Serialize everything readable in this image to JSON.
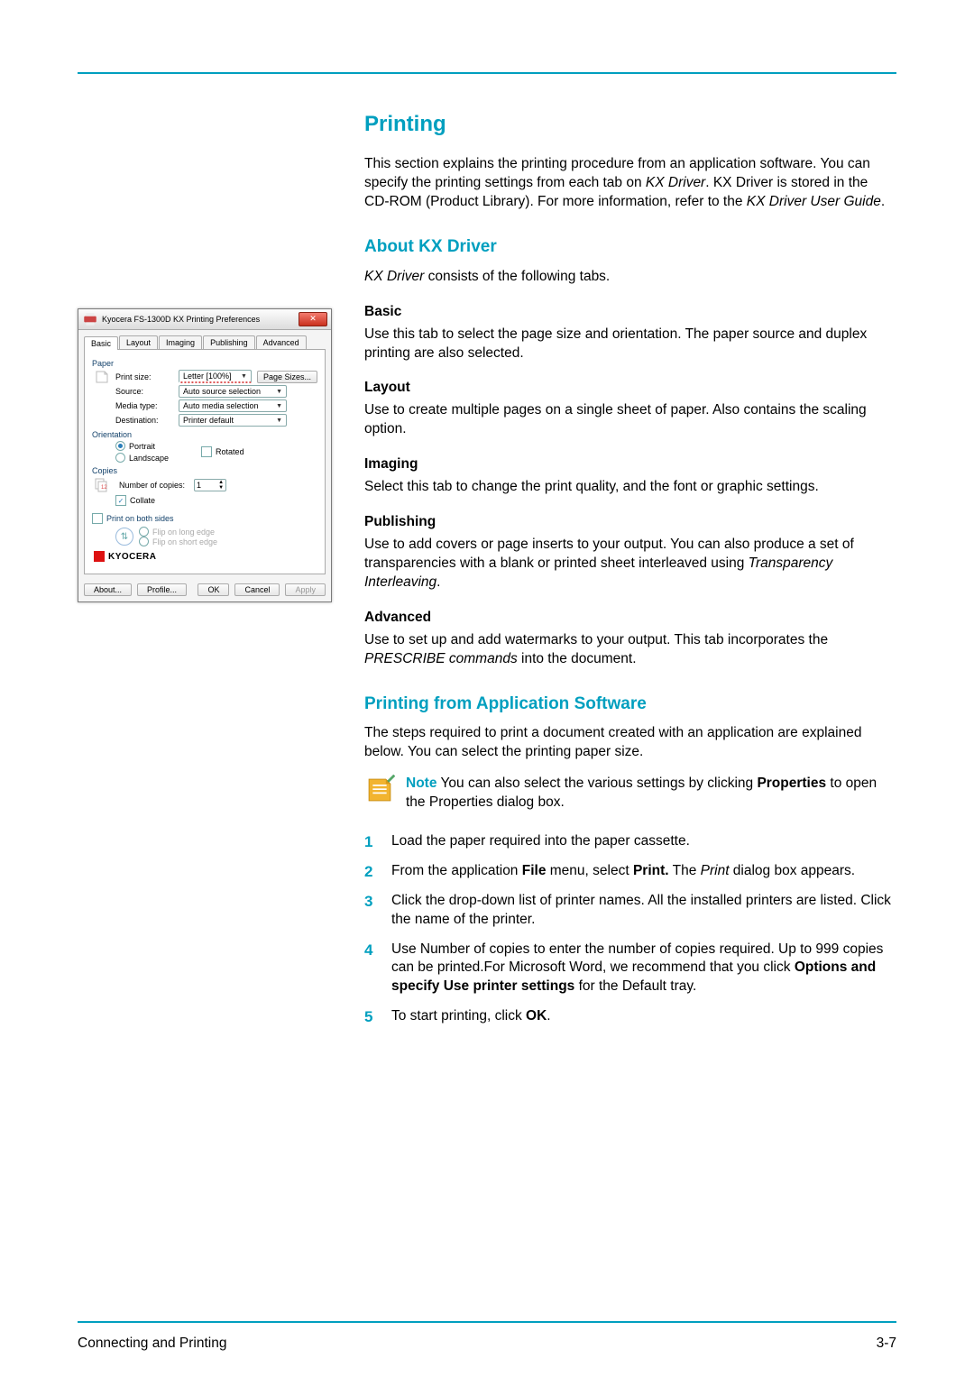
{
  "heading": "Printing",
  "intro": {
    "p1": "This section explains the printing procedure from an application software. You can specify the printing settings from each tab on ",
    "kx": "KX Driver",
    "p2": ". KX Driver is stored in the CD-ROM (Product Library). For more information, refer to the ",
    "guide": "KX Driver User Guide",
    "p3": "."
  },
  "about": {
    "title": "About KX Driver",
    "lead_pre": "KX Driver",
    "lead_post": " consists of the following tabs.",
    "tabs": {
      "basic": {
        "name": "Basic",
        "desc": "Use this tab to select the page size and orientation. The paper source and duplex printing are also selected."
      },
      "layout": {
        "name": "Layout",
        "desc": "Use to create multiple pages on a single sheet of paper. Also contains the scaling option."
      },
      "imaging": {
        "name": "Imaging",
        "desc": "Select this tab to change the print quality, and the font or graphic settings."
      },
      "publishing": {
        "name": "Publishing",
        "desc_pre": "Use to add covers or page inserts to your output. You can also produce a set of transparencies with a blank or printed sheet interleaved using ",
        "desc_it": "Transparency Interleaving",
        "desc_post": "."
      },
      "advanced": {
        "name": "Advanced",
        "desc_pre": "Use to set up and add watermarks to your output. This tab incorporates the ",
        "desc_it": "PRESCRIBE commands",
        "desc_post": " into the document."
      }
    }
  },
  "printapp": {
    "title": "Printing from Application Software",
    "lead": "The steps required to print a document created with an application are explained below. You can select the printing paper size.",
    "note_word": "Note",
    "note_pre": "  You can also select the various settings by clicking ",
    "note_bold": "Properties",
    "note_post": " to open the Properties dialog box.",
    "steps": {
      "s1": "Load the paper required into the paper cassette.",
      "s2_pre": "From the application ",
      "s2_b1": "File",
      "s2_mid1": " menu, select ",
      "s2_b2": "Print.",
      "s2_mid2": " The ",
      "s2_it": "Print",
      "s2_post": " dialog box appears.",
      "s3": "Click the drop-down list of printer names. All the installed printers are listed. Click the name of the printer.",
      "s4_pre": "Use Number of copies to enter the number of copies required. Up to 999 copies can be printed.For Microsoft Word, we recommend that you click ",
      "s4_b": "Options and specify Use printer settings",
      "s4_post": " for the Default tray.",
      "s5_pre": "To start printing, click ",
      "s5_b": "OK",
      "s5_post": "."
    }
  },
  "dialog": {
    "title": "Kyocera FS-1300D KX Printing Preferences",
    "close": "✕",
    "tabs": [
      "Basic",
      "Layout",
      "Imaging",
      "Publishing",
      "Advanced"
    ],
    "paper": "Paper",
    "print_size_lbl": "Print size:",
    "print_size_val": "Letter [100%]",
    "page_sizes_btn": "Page Sizes...",
    "source_lbl": "Source:",
    "source_val": "Auto source selection",
    "media_lbl": "Media type:",
    "media_val": "Auto media selection",
    "dest_lbl": "Destination:",
    "dest_val": "Printer default",
    "orientation": "Orientation",
    "portrait": "Portrait",
    "landscape": "Landscape",
    "rotated": "Rotated",
    "copies": "Copies",
    "num_copies_lbl": "Number of copies:",
    "num_copies_val": "1",
    "collate": "Collate",
    "duplex": "Print on both sides",
    "flip_long": "Flip on long edge",
    "flip_short": "Flip on short edge",
    "brand": "KYOCERA",
    "btn_about": "About...",
    "btn_profile": "Profile...",
    "btn_ok": "OK",
    "btn_cancel": "Cancel",
    "btn_apply": "Apply"
  },
  "footer": {
    "left": "Connecting and Printing",
    "right": "3-7"
  }
}
